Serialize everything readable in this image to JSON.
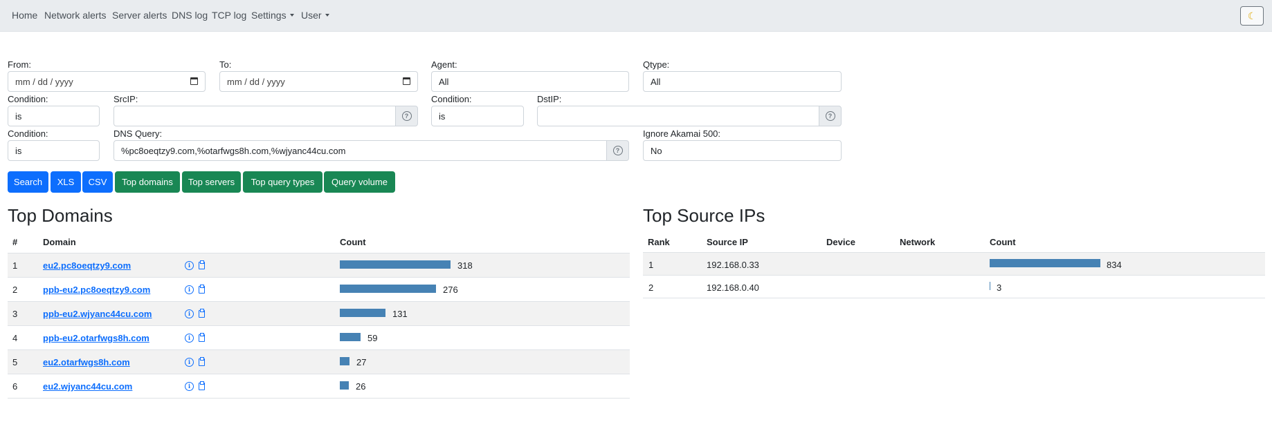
{
  "nav": {
    "items": [
      "Home",
      "Network alerts",
      "Server alerts",
      "DNS log",
      "TCP log"
    ],
    "settings_label": "Settings",
    "user_label": "User",
    "theme_icon": "moon-icon"
  },
  "filters": {
    "from_label": "From:",
    "from_placeholder": "mm / dd / yyyy",
    "to_label": "To:",
    "to_placeholder": "mm / dd / yyyy",
    "agent_label": "Agent:",
    "agent_value": "All",
    "qtype_label": "Qtype:",
    "qtype_value": "All",
    "cond1_label": "Condition:",
    "cond1_value": "is",
    "srcip_label": "SrcIP:",
    "srcip_value": "",
    "cond2_label": "Condition:",
    "cond2_value": "is",
    "dstip_label": "DstIP:",
    "dstip_value": "",
    "cond3_label": "Condition:",
    "cond3_value": "is",
    "dnsquery_label": "DNS Query:",
    "dnsquery_value": "%pc8oeqtzy9.com,%otarfwgs8h.com,%wjyanc44cu.com",
    "akamai_label": "Ignore Akamai 500:",
    "akamai_value": "No",
    "help_glyph": "?"
  },
  "buttons": {
    "search": "Search",
    "xls": "XLS",
    "csv": "CSV",
    "top_domains": "Top domains",
    "top_servers": "Top servers",
    "top_query_types": "Top query types",
    "query_volume": "Query volume"
  },
  "top_domains": {
    "title": "Top Domains",
    "headers": {
      "rank": "#",
      "domain": "Domain",
      "count": "Count"
    },
    "rows": [
      {
        "rank": "1",
        "domain": "eu2.pc8oeqtzy9.com",
        "count": 318
      },
      {
        "rank": "2",
        "domain": "ppb-eu2.pc8oeqtzy9.com",
        "count": 276
      },
      {
        "rank": "3",
        "domain": "ppb-eu2.wjyanc44cu.com",
        "count": 131
      },
      {
        "rank": "4",
        "domain": "ppb-eu2.otarfwgs8h.com",
        "count": 59
      },
      {
        "rank": "5",
        "domain": "eu2.otarfwgs8h.com",
        "count": 27
      },
      {
        "rank": "6",
        "domain": "eu2.wjyanc44cu.com",
        "count": 26
      }
    ]
  },
  "top_source_ips": {
    "title": "Top Source IPs",
    "headers": {
      "rank": "Rank",
      "source_ip": "Source IP",
      "device": "Device",
      "network": "Network",
      "count": "Count"
    },
    "rows": [
      {
        "rank": "1",
        "source_ip": "192.168.0.33",
        "device": "",
        "network": "",
        "count": 834
      },
      {
        "rank": "2",
        "source_ip": "192.168.0.40",
        "device": "",
        "network": "",
        "count": 3
      }
    ]
  },
  "colors": {
    "bar": "#4682b4",
    "primary": "#0d6efd",
    "success": "#198754"
  }
}
